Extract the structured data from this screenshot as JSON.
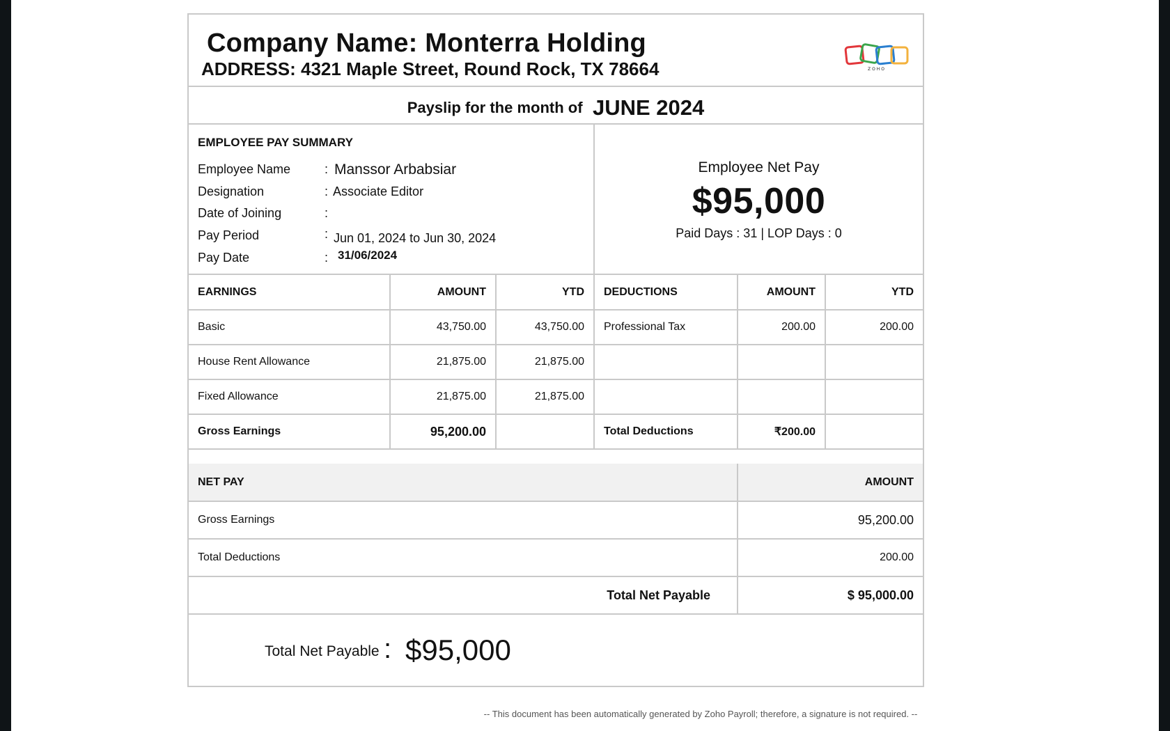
{
  "header": {
    "company_name": "Company Name: Monterra Holding",
    "address": "ADDRESS: 4321 Maple Street, Round Rock, TX 78664",
    "logo_text": "ZOHO",
    "logo_colors": [
      "#e2373b",
      "#3aa54b",
      "#2a7fd0",
      "#f3b23d"
    ]
  },
  "month": {
    "label": "Payslip for the month of",
    "value": "JUNE 2024"
  },
  "summary": {
    "title": "EMPLOYEE PAY SUMMARY",
    "fields": [
      {
        "label": "Employee Name",
        "value": "Manssor Arbabsiar"
      },
      {
        "label": "Designation",
        "value": "Associate Editor"
      },
      {
        "label": "Date of Joining",
        "value": ""
      },
      {
        "label": "Pay Period",
        "value": "Jun 01, 2024 to Jun 30, 2024"
      },
      {
        "label": "Pay Date",
        "value": "31/06/2024"
      }
    ],
    "colon": ":"
  },
  "net_pay_box": {
    "label": "Employee Net Pay",
    "value": "$95,000",
    "days": "Paid Days : 31 | LOP Days : 0"
  },
  "earnings_table": {
    "headers": {
      "earnings": "EARNINGS",
      "amount": "AMOUNT",
      "ytd": "YTD",
      "deductions": "DEDUCTIONS",
      "ded_amount": "AMOUNT",
      "ded_ytd": "YTD"
    },
    "rows": [
      {
        "earning": "Basic",
        "amount": "43,750.00",
        "ytd": "43,750.00",
        "deduction": "Professional Tax",
        "ded_amount": "200.00",
        "ded_ytd": "200.00"
      },
      {
        "earning": "House Rent Allowance",
        "amount": "21,875.00",
        "ytd": "21,875.00",
        "deduction": "",
        "ded_amount": "",
        "ded_ytd": ""
      },
      {
        "earning": "Fixed Allowance",
        "amount": "21,875.00",
        "ytd": "21,875.00",
        "deduction": "",
        "ded_amount": "",
        "ded_ytd": ""
      }
    ],
    "totals": {
      "gross_label": "Gross Earnings",
      "gross_amount": "95,200.00",
      "deductions_label": "Total Deductions",
      "deductions_amount": "₹200.00"
    }
  },
  "net_pay_table": {
    "header": "NET PAY",
    "amount_header": "AMOUNT",
    "gross_label": "Gross Earnings",
    "gross_value": "95,200.00",
    "deductions_label": "Total Deductions",
    "deductions_value": "200.00",
    "total_label": "Total Net Payable",
    "total_value": "$  95,000.00"
  },
  "bottom_total": {
    "label": "Total Net Payable",
    "colon": ":",
    "value": "$95,000"
  },
  "footer": {
    "note": "-- This document has been automatically generated by Zoho Payroll; therefore, a signature is not required. --"
  }
}
